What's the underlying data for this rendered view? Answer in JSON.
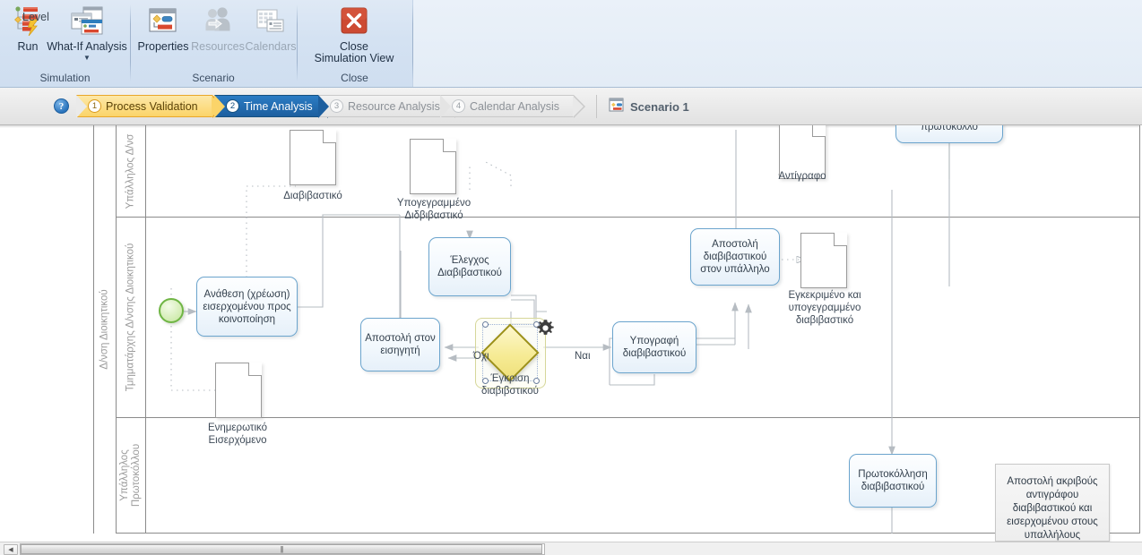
{
  "ribbon": {
    "groups": [
      {
        "label": "Simulation"
      },
      {
        "label": "Scenario"
      },
      {
        "label": "Close"
      }
    ],
    "buttons": {
      "run": {
        "label": "Run",
        "icon": "run-simulation-icon",
        "enabled": true
      },
      "what_if": {
        "label": "What-If Analysis",
        "icon": "what-if-analysis-icon",
        "enabled": true,
        "has_dropdown": true
      },
      "properties": {
        "label": "Properties",
        "icon": "properties-icon",
        "enabled": true
      },
      "resources": {
        "label": "Resources",
        "icon": "resources-people-icon",
        "enabled": false
      },
      "calendars": {
        "label": "Calendars",
        "icon": "calendar-icon",
        "enabled": false
      },
      "close_simulation_view": {
        "label": "Close\nSimulation View",
        "line1": "Close",
        "line2": "Simulation View",
        "icon": "close-x-icon",
        "enabled": true
      }
    }
  },
  "levelbar": {
    "label": "Level",
    "help_icon": "question-mark-icon",
    "steps": [
      {
        "num": "1",
        "label": "Process Validation",
        "state": "completed"
      },
      {
        "num": "2",
        "label": "Time Analysis",
        "state": "current"
      },
      {
        "num": "3",
        "label": "Resource Analysis",
        "state": "disabled"
      },
      {
        "num": "4",
        "label": "Calendar Analysis",
        "state": "disabled"
      }
    ],
    "scenario": {
      "label": "Scenario 1",
      "icon": "scenario-icon"
    }
  },
  "colors": {
    "accent_blue": "#1d5f9f",
    "completed_yellow": "#fbd469",
    "task_border": "#6ba4cd",
    "gateway_fill": "#f6eb95",
    "gateway_border": "#9c9018",
    "start_event_border": "#6fb544",
    "pool_border": "#8b8b8b",
    "lane_label": "#9b9b9b"
  },
  "diagram": {
    "pool_title": "Δ/νση Διοικητικού",
    "lanes": [
      {
        "title": "Υπάλληλος Δ/νσ",
        "id": "lane-employee-direction"
      },
      {
        "title": "Τμηματάρχης Δ/νσης Διοικητικού",
        "id": "lane-section-head"
      },
      {
        "title": "Υπάλληλος\nΠρωτοκόλλου",
        "title_line1": "Υπάλληλος",
        "title_line2": "Πρωτοκόλλου",
        "id": "lane-protocol-clerk"
      }
    ],
    "tasks": [
      {
        "id": "task-assign",
        "text": "Ανάθεση (χρέωση) εισερχομένου προς κοινοποίηση"
      },
      {
        "id": "task-check-transmittal",
        "text": "Έλεγχος Διαβιβαστικού"
      },
      {
        "id": "task-send-to-rapporteur",
        "text": "Αποστολή στον εισηγητή"
      },
      {
        "id": "task-sign-transmittal",
        "text": "Υπογραφή διαβιβαστικού"
      },
      {
        "id": "task-send-to-employee",
        "text": "Αποστολή διαβιβαστικού στον υπάλληλο"
      },
      {
        "id": "task-protocol-transmittal",
        "text": "Πρωτοκόλληση διαβιβαστικού"
      },
      {
        "id": "task-protocol-top",
        "text": "πρωτόκολλο"
      }
    ],
    "gateway": {
      "id": "gateway-approval",
      "label": "Έγκριση διαβιβστικού",
      "selected": true,
      "gear_icon": "gear-icon",
      "flow_labels": {
        "no": "Όχι",
        "yes": "Ναι"
      }
    },
    "documents": [
      {
        "id": "doc-transmittal",
        "label": "Διαβιβαστικό"
      },
      {
        "id": "doc-signed-transmittal",
        "label": "Υπογεγραμμένο Διδβιβαστικό"
      },
      {
        "id": "doc-copy",
        "label": "Αντίγραφο"
      },
      {
        "id": "doc-approved-signed",
        "label": "Εγκεκριμένο και υπογεγραμμένο διαβιβαστικό"
      },
      {
        "id": "doc-incoming-info",
        "label": "Ενημερωτικό Εισερχόμενο"
      }
    ],
    "annotation": {
      "id": "annotation-send-copy",
      "text": "Αποστολή ακριβούς αντιγράφου διαβιβαστικού και εισερχομένου στους υπαλλήλους"
    },
    "start_event": {
      "id": "start-event",
      "icon": "start-event-icon"
    }
  },
  "scrollbar": {
    "left_arrow_icon": "arrow-left-icon",
    "grip": "|||"
  }
}
